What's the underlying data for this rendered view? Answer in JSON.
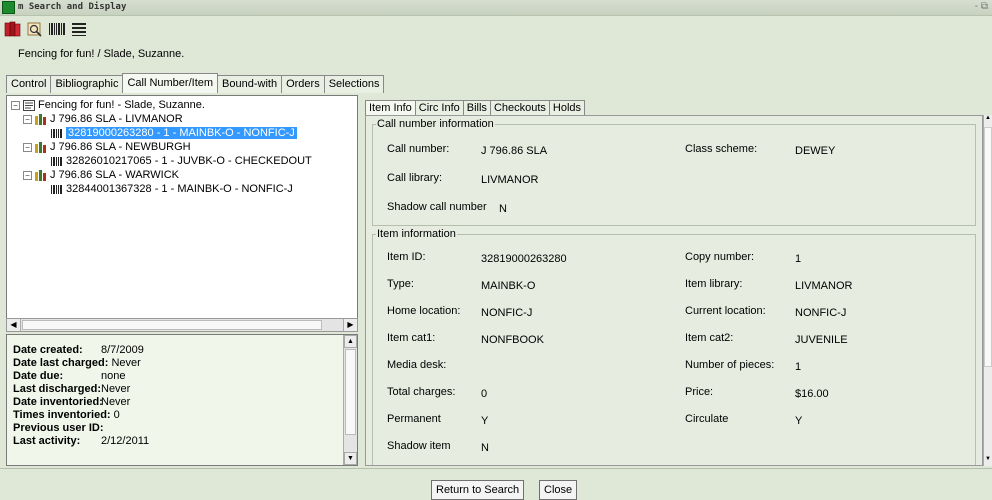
{
  "window": {
    "title": "m Search and Display",
    "controls": "- ⧉"
  },
  "header": {
    "item_title": "Fencing for fun! / Slade, Suzanne."
  },
  "main_tabs": [
    {
      "label": "Control"
    },
    {
      "label": "Bibliographic"
    },
    {
      "label": "Call Number/Item"
    },
    {
      "label": "Bound-with"
    },
    {
      "label": "Orders"
    },
    {
      "label": "Selections"
    }
  ],
  "tree": {
    "root": "Fencing for fun! - Slade, Suzanne.",
    "nodes": [
      {
        "callnum": "J 796.86 SLA - LIVMANOR",
        "item": "32819000263280 - 1 - MAINBK-O - NONFIC-J"
      },
      {
        "callnum": "J 796.86 SLA - NEWBURGH",
        "item": "32826010217065 - 1 - JUVBK-O - CHECKEDOUT"
      },
      {
        "callnum": "J 796.86 SLA - WARWICK",
        "item": "32844001367328 - 1 - MAINBK-O - NONFIC-J"
      }
    ]
  },
  "item_summary": [
    {
      "key": "Date created:",
      "value": "8/7/2009"
    },
    {
      "key": "Date last charged:",
      "value": "Never"
    },
    {
      "key": "Date due:",
      "value": "none"
    },
    {
      "key": "Last discharged:",
      "value": "Never"
    },
    {
      "key": "Date inventoried:",
      "value": "Never"
    },
    {
      "key": "Times inventoried:",
      "value": "0"
    },
    {
      "key": "Previous user ID:",
      "value": ""
    },
    {
      "key": "Last activity:",
      "value": "2/12/2011"
    }
  ],
  "sub_tabs": [
    {
      "label": "Item Info"
    },
    {
      "label": "Circ Info"
    },
    {
      "label": "Bills"
    },
    {
      "label": "Checkouts"
    },
    {
      "label": "Holds"
    }
  ],
  "call_number_info": {
    "legend": "Call number information",
    "call_number_label": "Call number:",
    "call_number": "J 796.86 SLA",
    "class_scheme_label": "Class scheme:",
    "class_scheme": "DEWEY",
    "call_library_label": "Call library:",
    "call_library": "LIVMANOR",
    "shadow_label": "Shadow call number",
    "shadow": "N"
  },
  "item_info": {
    "legend": "Item information",
    "item_id_label": "Item ID:",
    "item_id": "32819000263280",
    "copy_number_label": "Copy number:",
    "copy_number": "1",
    "type_label": "Type:",
    "type": "MAINBK-O",
    "item_library_label": "Item library:",
    "item_library": "LIVMANOR",
    "home_location_label": "Home location:",
    "home_location": "NONFIC-J",
    "current_location_label": "Current location:",
    "current_location": "NONFIC-J",
    "item_cat1_label": "Item cat1:",
    "item_cat1": "NONFBOOK",
    "item_cat2_label": "Item cat2:",
    "item_cat2": "JUVENILE",
    "media_desk_label": "Media desk:",
    "media_desk": "",
    "number_of_pieces_label": "Number of pieces:",
    "number_of_pieces": "1",
    "total_charges_label": "Total charges:",
    "total_charges": "0",
    "price_label": "Price:",
    "price": "$16.00",
    "permanent_label": "Permanent",
    "permanent": "Y",
    "circulate_label": "Circulate",
    "circulate": "Y",
    "shadow_item_label": "Shadow item",
    "shadow_item": "N"
  },
  "buttons": {
    "return_to_search": "Return to Search",
    "close": "Close"
  },
  "colors": {
    "background": "#dfe8d6",
    "selection": "#3399ff",
    "panel": "#e6ede0"
  }
}
